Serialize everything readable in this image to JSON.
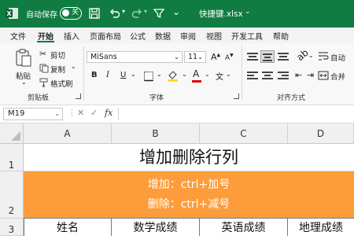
{
  "titlebar": {
    "autosave_label": "自动保存",
    "autosave_state": "关",
    "filename": "快捷键.xlsx",
    "icons": [
      "excel-icon",
      "save-icon",
      "undo-icon",
      "redo-icon",
      "filter-icon",
      "more-icon",
      "chevron-down-icon"
    ]
  },
  "tabs": [
    "文件",
    "开始",
    "插入",
    "页面布局",
    "公式",
    "数据",
    "审阅",
    "视图",
    "开发工具",
    "帮助"
  ],
  "active_tab": "开始",
  "ribbon": {
    "clipboard": {
      "paste": "粘贴",
      "cut": "剪切",
      "copy": "复制",
      "format_painter": "格式刷",
      "group_label": "剪贴板"
    },
    "font": {
      "font_name": "MiSans",
      "font_size": "11",
      "group_label": "字体"
    },
    "alignment": {
      "wrap": "自动",
      "merge": "合并",
      "group_label": "对齐方式"
    }
  },
  "formula_bar": {
    "name_box": "M19",
    "cancel": "✕",
    "confirm": "✓",
    "fx": "fx",
    "formula": ""
  },
  "sheet": {
    "columns": [
      "A",
      "B",
      "C",
      "D"
    ],
    "rows": [
      "1",
      "2",
      "3"
    ],
    "title": "增加删除行列",
    "line1": "增加：ctrl+加号",
    "line2": "删除：ctrl+减号",
    "headers": [
      "姓名",
      "数学成绩",
      "英语成绩",
      "地理成绩"
    ]
  },
  "colors": {
    "excel_green": "#107c41",
    "highlight_orange": "#fd9c3a"
  }
}
